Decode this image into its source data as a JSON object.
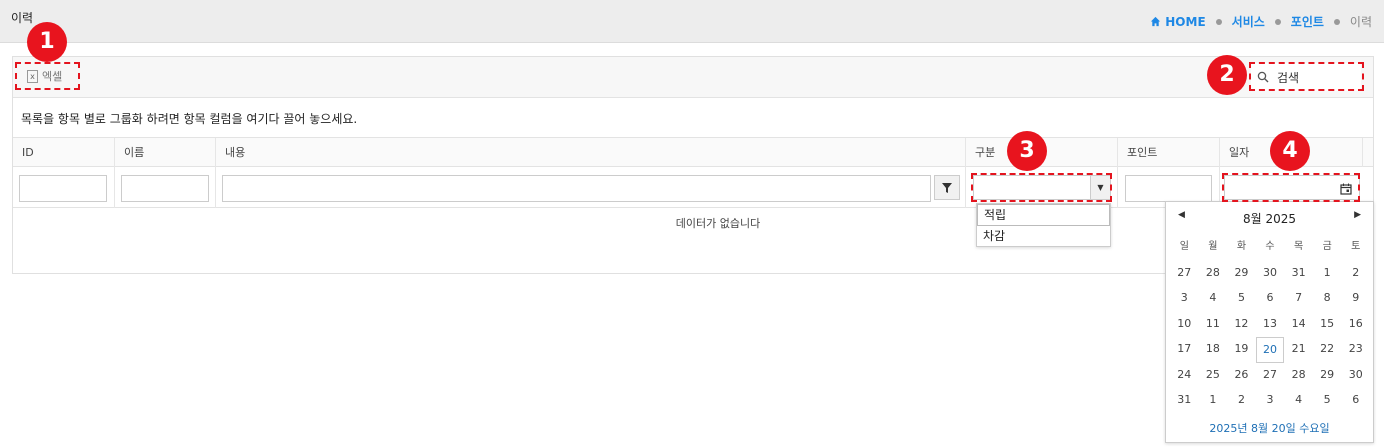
{
  "header": {
    "title": "이력",
    "breadcrumb": [
      "HOME",
      "서비스",
      "포인트",
      "이력"
    ]
  },
  "toolbar": {
    "excel_label": "엑셀",
    "search_placeholder": "검색"
  },
  "group_hint": "목록을 항목 별로 그룹화 하려면 항목 컬럼을 여기다 끌어 놓으세요.",
  "columns": [
    "ID",
    "이름",
    "내용",
    "구분",
    "포인트",
    "일자"
  ],
  "empty_message": "데이터가 없습니다",
  "type_dropdown": {
    "options": [
      "적립",
      "차감"
    ]
  },
  "calendar": {
    "title": "8월 2025",
    "weekdays": [
      "일",
      "월",
      "화",
      "수",
      "목",
      "금",
      "토"
    ],
    "weeks": [
      [
        "27",
        "28",
        "29",
        "30",
        "31",
        "1",
        "2"
      ],
      [
        "3",
        "4",
        "5",
        "6",
        "7",
        "8",
        "9"
      ],
      [
        "10",
        "11",
        "12",
        "13",
        "14",
        "15",
        "16"
      ],
      [
        "17",
        "18",
        "19",
        "20",
        "21",
        "22",
        "23"
      ],
      [
        "24",
        "25",
        "26",
        "27",
        "28",
        "29",
        "30"
      ],
      [
        "31",
        "1",
        "2",
        "3",
        "4",
        "5",
        "6"
      ]
    ],
    "today": "20",
    "footer": "2025년 8월 20일 수요일"
  },
  "callouts": [
    "1",
    "2",
    "3",
    "4"
  ],
  "colors": {
    "accent": "#1e88e5",
    "callout": "#e8141e"
  }
}
